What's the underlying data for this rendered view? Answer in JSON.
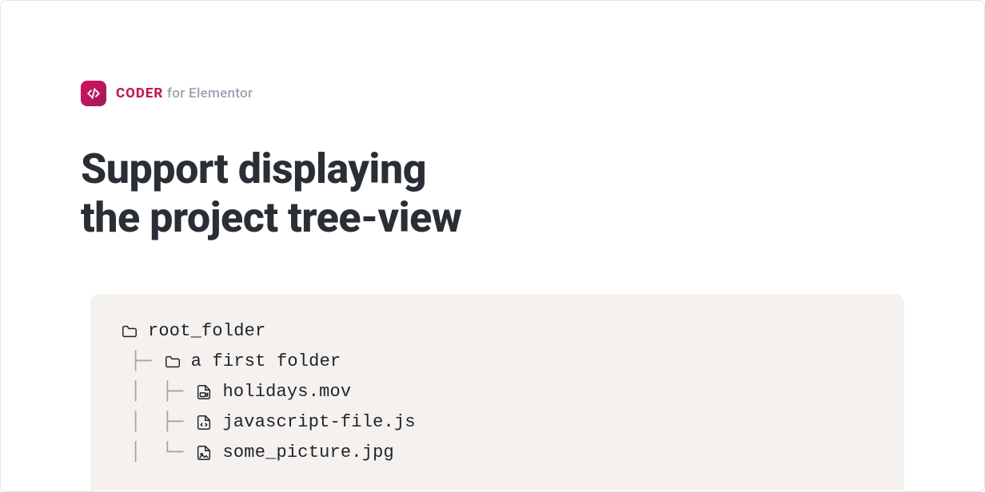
{
  "brand": {
    "name": "CODER",
    "suffix": "for Elementor"
  },
  "headline": {
    "line1": "Support displaying",
    "line2": "the project tree-view"
  },
  "tree": {
    "items": [
      {
        "label": "root_folder",
        "icon": "folder",
        "depth": 0,
        "connector": ""
      },
      {
        "label": "a first folder",
        "icon": "folder",
        "depth": 1,
        "connector": "├─ "
      },
      {
        "label": "holidays.mov",
        "icon": "file-video",
        "depth": 2,
        "connector": "│  ├─ "
      },
      {
        "label": "javascript-file.js",
        "icon": "file-code",
        "depth": 2,
        "connector": "│  ├─ "
      },
      {
        "label": "some_picture.jpg",
        "icon": "file-image",
        "depth": 2,
        "connector": "│  └─ "
      }
    ]
  }
}
